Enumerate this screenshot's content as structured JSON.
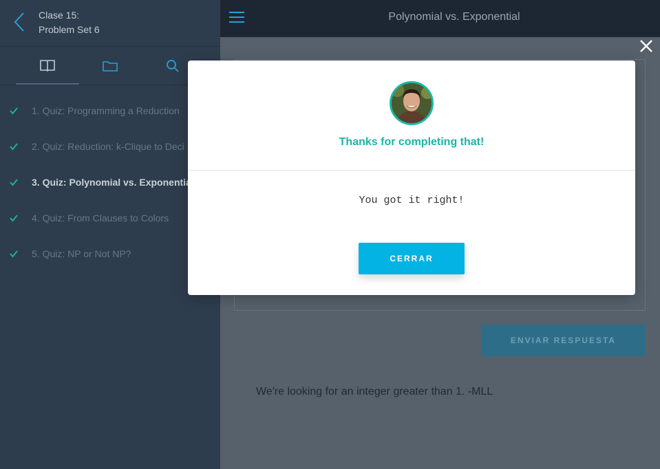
{
  "sidebar": {
    "lesson_line1": "Clase 15:",
    "lesson_line2": "Problem Set 6",
    "items": [
      {
        "label": "1. Quiz: Programming a Reduction"
      },
      {
        "label": "2. Quiz: Reduction: k-Clique to Deci"
      },
      {
        "label": "3. Quiz: Polynomial vs. Exponentia"
      },
      {
        "label": "4. Quiz: From Clauses to Colors"
      },
      {
        "label": "5. Quiz: NP or Not NP?"
      }
    ]
  },
  "topbar": {
    "title": "Polynomial vs. Exponential"
  },
  "content": {
    "submit_label": "ENVIAR RESPUESTA",
    "hint": "We're looking for an integer greater than 1. -MLL"
  },
  "modal": {
    "title": "Thanks for completing that!",
    "message": "You got it right!",
    "close_label": "CERRAR"
  },
  "colors": {
    "accent": "#02b3e4",
    "success": "#1cb3a5",
    "check": "#18b39e"
  }
}
